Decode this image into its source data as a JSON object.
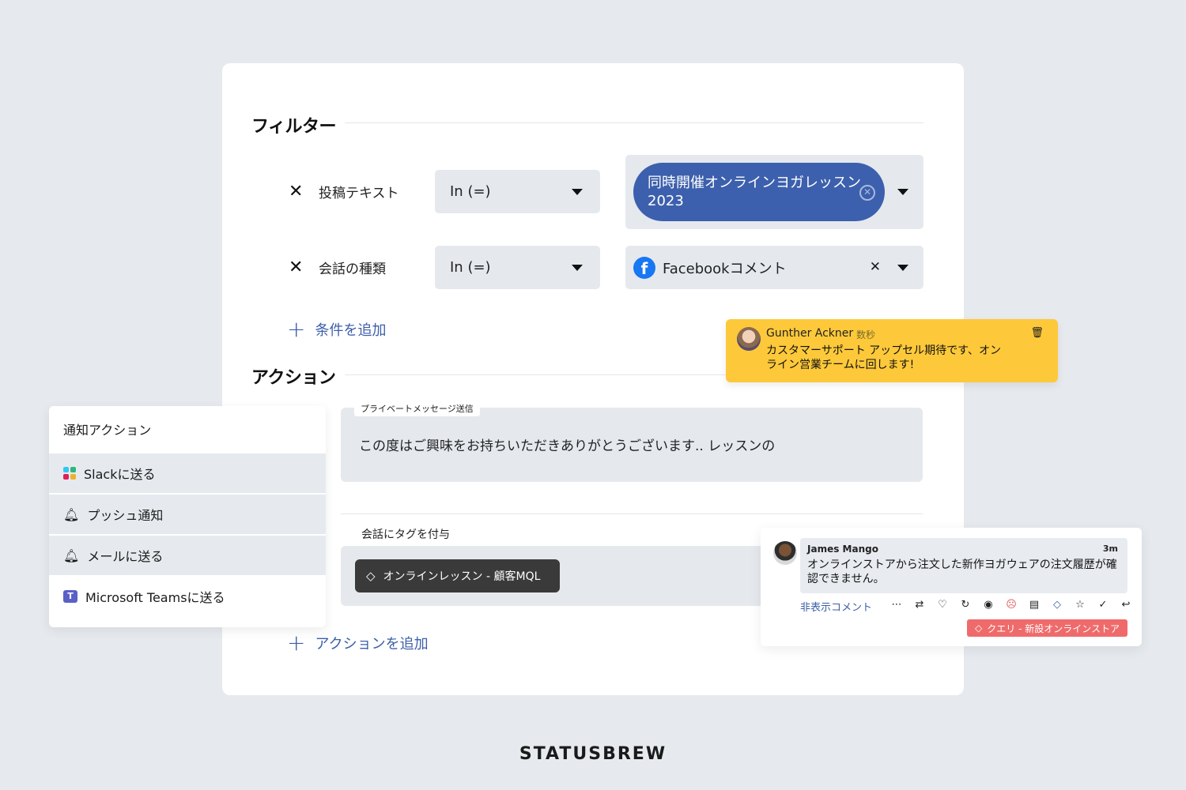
{
  "filters": {
    "title": "フィルター",
    "rows": [
      {
        "field": "投稿テキスト",
        "operator": "In (=)",
        "value": "同時開催オンラインヨガレッスン 2023"
      },
      {
        "field": "会話の種類",
        "operator": "In (=)",
        "value": "Facebookコメント"
      }
    ],
    "add_condition": "条件を追加"
  },
  "actions": {
    "title": "アクション",
    "private_message_caption": "プライベートメッセージ送信",
    "private_message_text": "この度はご興味をお持ちいただきありがとうございます.. レッスンの",
    "tag_caption": "会話にタグを付与",
    "tag_label": "オンラインレッスン - 顧客MQL",
    "add_action": "アクションを追加"
  },
  "notification_panel": {
    "title": "通知アクション",
    "items": [
      {
        "label": "Slackに送る",
        "icon": "slack-icon"
      },
      {
        "label": "プッシュ通知",
        "icon": "bell-icon"
      },
      {
        "label": "メールに送る",
        "icon": "bell-icon"
      },
      {
        "label": "Microsoft Teamsに送る",
        "icon": "teams-icon"
      }
    ]
  },
  "note": {
    "author": "Gunther Ackner",
    "time": "数秒",
    "text": "カスタマーサポート アップセル期待です、オンライン営業チームに回します!"
  },
  "comment": {
    "author": "James Mango",
    "time": "3m",
    "text": "オンラインストアから注文した新作ヨガウェアの注文履歴が確認できません。",
    "hide_link": "非表示コメント",
    "tag": "クエリ - 新設オンラインストア"
  },
  "brand": "STATUSBREW",
  "colors": {
    "accent": "#3c60ad",
    "note": "#fdc93a",
    "tag_red": "#ef6b6b",
    "background": "#e6eaee"
  }
}
